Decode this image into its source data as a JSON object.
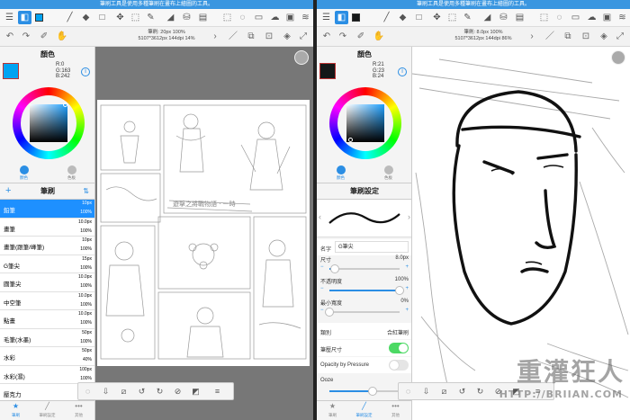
{
  "left": {
    "status_text": "筆刷工具是使用多種筆刷在畫布上繪圖的工具。",
    "brush_info": {
      "line1": "筆刷: 20px 100%",
      "line2": "5107*3612px 144dpi 14%"
    },
    "color_panel": {
      "title": "顏色",
      "r": "R:0",
      "g": "G:163",
      "b": "B:242",
      "swatch": "#00a3f2"
    },
    "color_tabs": [
      {
        "label": "顏色"
      },
      {
        "label": "色板"
      }
    ],
    "brush_panel": {
      "title": "筆刷"
    },
    "brushes": [
      {
        "name": "鉛筆",
        "size": "10px",
        "opacity": "100%"
      },
      {
        "name": "畫筆",
        "size": "10.0px",
        "opacity": "100%"
      },
      {
        "name": "畫筆(跟筆/峰筆)",
        "size": "10px",
        "opacity": "100%"
      },
      {
        "name": "G筆尖",
        "size": "15px",
        "opacity": "100%"
      },
      {
        "name": "圓筆尖",
        "size": "10.0px",
        "opacity": "100%"
      },
      {
        "name": "中空筆",
        "size": "10.0px",
        "opacity": "100%"
      },
      {
        "name": "點畫",
        "size": "10.0px",
        "opacity": "100%"
      },
      {
        "name": "毛筆(水墨)",
        "size": "50px",
        "opacity": "100%"
      },
      {
        "name": "水彩",
        "size": "50px",
        "opacity": "40%"
      },
      {
        "name": "水彩(濕)",
        "size": "100px",
        "opacity": "100%"
      },
      {
        "name": "壓克力",
        "size": "50px",
        "opacity": "100%"
      }
    ],
    "bottom_tabs": [
      {
        "label": "筆刷"
      },
      {
        "label": "筆刷設定"
      },
      {
        "label": "其他"
      }
    ]
  },
  "right": {
    "status_text": "筆刷工具是使用多種筆刷在畫布上繪圖的工具。",
    "brush_info": {
      "line1": "筆刷: 8.0px 100%",
      "line2": "5107*3612px 144dpi 86%"
    },
    "color_panel": {
      "title": "顏色",
      "r": "R:21",
      "g": "G:23",
      "b": "B:24",
      "swatch": "#151718"
    },
    "color_tabs": [
      {
        "label": "顏色"
      },
      {
        "label": "色板"
      }
    ],
    "settings": {
      "title": "筆刷設定",
      "name_label": "名字",
      "name_value": "G筆尖",
      "size_label": "尺寸",
      "size_value": "8.0px",
      "size_level": 0.08,
      "opacity_label": "不透明度",
      "opacity_value": "100%",
      "opacity_level": 1.0,
      "min_width_label": "最小寬度",
      "min_width_value": "0%",
      "min_width_level": 0.0,
      "type_label": "類別",
      "type_value": "合紅筆刷",
      "pen_size_label": "筆壓尺寸",
      "opacity_pressure_label": "Opacity by Pressure",
      "ooze_label": "Ooze"
    },
    "bottom_tabs": [
      {
        "label": "筆刷"
      },
      {
        "label": "筆刷設定"
      },
      {
        "label": "其他"
      }
    ]
  },
  "watermark": {
    "brand": "重灌狂人",
    "url": "HTTP://BRIIAN.COM"
  }
}
